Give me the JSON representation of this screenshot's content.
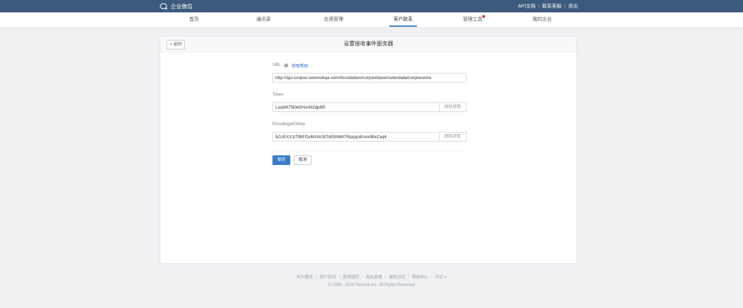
{
  "brand": {
    "name": "企业微信",
    "icon": "chat-bubble-icon"
  },
  "top_links": [
    "API文档",
    "联系客服",
    "退出"
  ],
  "nav": {
    "items": [
      {
        "label": "首页",
        "active": false,
        "badge": false
      },
      {
        "label": "通讯录",
        "active": false,
        "badge": false
      },
      {
        "label": "应用管理",
        "active": false,
        "badge": false
      },
      {
        "label": "客户联系",
        "active": true,
        "badge": false
      },
      {
        "label": "管理工具",
        "active": false,
        "badge": true
      },
      {
        "label": "我的企业",
        "active": false,
        "badge": false
      }
    ]
  },
  "panel": {
    "back_label": "« 返回",
    "title": "设置接收事件服务器"
  },
  "form": {
    "url": {
      "label": "URL",
      "help_icon": "question-circle-icon",
      "help_link": "获取帮助",
      "value": "http://api.corpwx.weimobqa.com/foundation/corpwxbase/suite/data/corpreceive"
    },
    "token": {
      "label": "Token",
      "value": "LuqWt75kM3Hsr6f2dp9R",
      "random_label": "随机获取"
    },
    "aes": {
      "label": "EncodingAESKey",
      "value": "5CcEXX1lTBIFDvMzWJ9TsEBNMi7Rpqqn8zvmBlxCwj4",
      "random_label": "随机获取"
    },
    "save_label": "保存",
    "cancel_label": "取消"
  },
  "footer": {
    "links": [
      "关于腾讯",
      "用户协议",
      "使用规范",
      "隐私政策",
      "更新日志",
      "帮助中心",
      "中文 ▾"
    ],
    "copyright": "© 1998 - 2020 Tencent Inc. All Rights Reserved"
  },
  "colors": {
    "topbar": "#3c5a7d",
    "accent": "#3b7bc6",
    "badge": "#e02e2e",
    "background": "#f0f1f3"
  }
}
